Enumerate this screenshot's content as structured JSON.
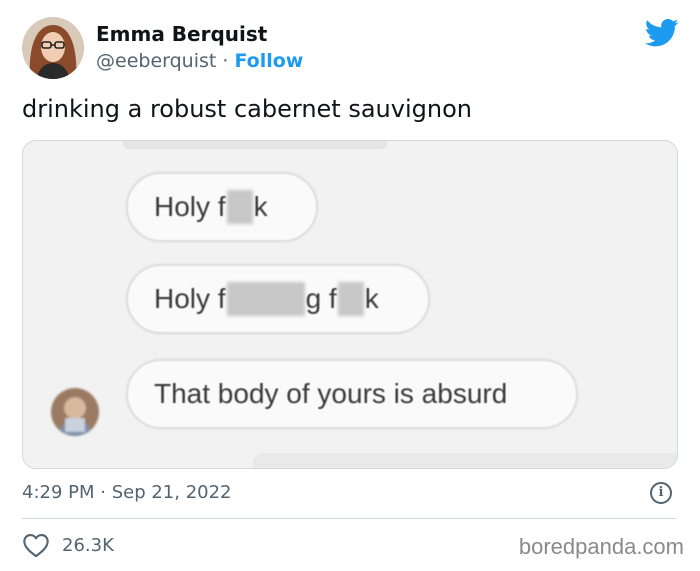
{
  "author": {
    "name": "Emma Berquist",
    "handle": "@eeberquist",
    "separator": " · ",
    "follow_label": "Follow"
  },
  "tweet": {
    "text": "drinking a robust cabernet sauvignon"
  },
  "media": {
    "bubble1_start": "Holy f",
    "bubble1_end": "k",
    "bubble2_start": "Holy f",
    "bubble2_mid": "g f",
    "bubble2_end": "k",
    "bubble3_text": "That body of yours is absurd"
  },
  "footer": {
    "timestamp": "4:29 PM · Sep 21, 2022",
    "info_glyph": "i",
    "likes": "26.3K"
  },
  "watermark": "boredpanda.com",
  "colors": {
    "accent": "#1d9bf0",
    "secondary_text": "#536471"
  },
  "icons": [
    "twitter-bird-icon",
    "info-icon",
    "heart-icon"
  ]
}
